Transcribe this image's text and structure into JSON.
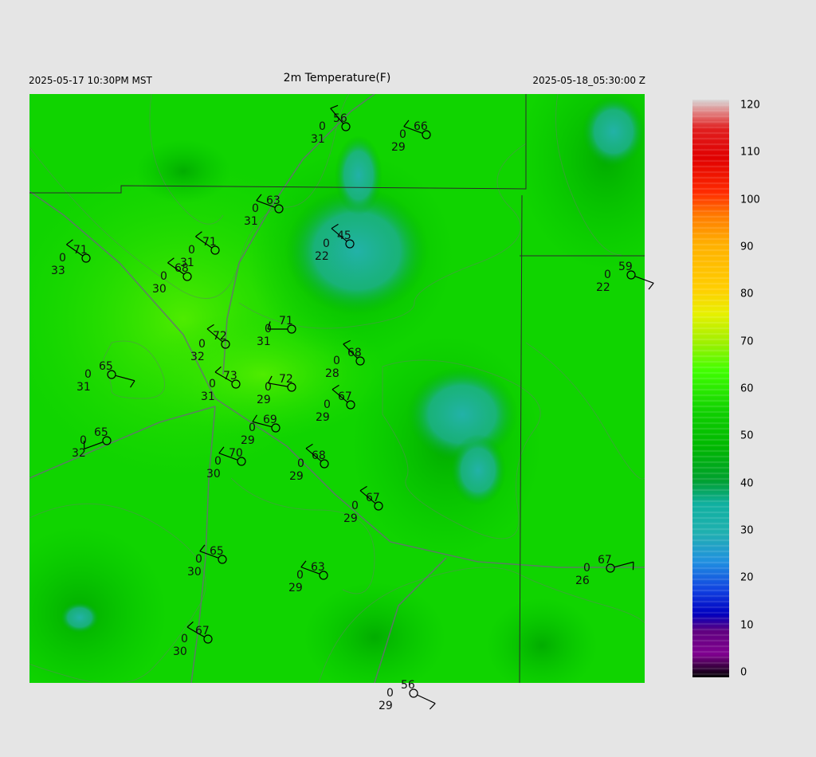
{
  "header": {
    "local_time": "2025-05-17 10:30PM MST",
    "title": "2m Temperature(F)",
    "utc_time": "2025-05-18_05:30:00 Z"
  },
  "colorbar": {
    "labels": [
      "120",
      "110",
      "100",
      "90",
      "80",
      "70",
      "60",
      "50",
      "40",
      "30",
      "20",
      "10",
      "0"
    ]
  },
  "stations": [
    {
      "t": "56",
      "p": "0",
      "d": "31"
    },
    {
      "t": "66",
      "p": "0",
      "d": "29"
    },
    {
      "t": "63",
      "p": "0",
      "d": "31"
    },
    {
      "t": "45",
      "p": "0",
      "d": "22"
    },
    {
      "t": "71",
      "p": "0",
      "d": "33"
    },
    {
      "t": "71",
      "p": "0",
      "d": "31"
    },
    {
      "t": "68",
      "p": "0",
      "d": "30"
    },
    {
      "t": "59",
      "p": "0",
      "d": "22"
    },
    {
      "t": "71",
      "p": "0",
      "d": "31"
    },
    {
      "t": "72",
      "p": "0",
      "d": "32"
    },
    {
      "t": "68",
      "p": "0",
      "d": "28"
    },
    {
      "t": "65",
      "p": "0",
      "d": "31"
    },
    {
      "t": "73",
      "p": "0",
      "d": "31"
    },
    {
      "t": "72",
      "p": "0",
      "d": "29"
    },
    {
      "t": "67",
      "p": "0",
      "d": "29"
    },
    {
      "t": "69",
      "p": "0",
      "d": "29"
    },
    {
      "t": "65",
      "p": "0",
      "d": "32"
    },
    {
      "t": "70",
      "p": "0",
      "d": "30"
    },
    {
      "t": "68",
      "p": "0",
      "d": "29"
    },
    {
      "t": "67",
      "p": "0",
      "d": "29"
    },
    {
      "t": "65",
      "p": "0",
      "d": "30"
    },
    {
      "t": "63",
      "p": "0",
      "d": "29"
    },
    {
      "t": "67",
      "p": "0",
      "d": "26"
    },
    {
      "t": "67",
      "p": "0",
      "d": "30"
    },
    {
      "t": "56",
      "p": "0",
      "d": "29"
    }
  ]
}
